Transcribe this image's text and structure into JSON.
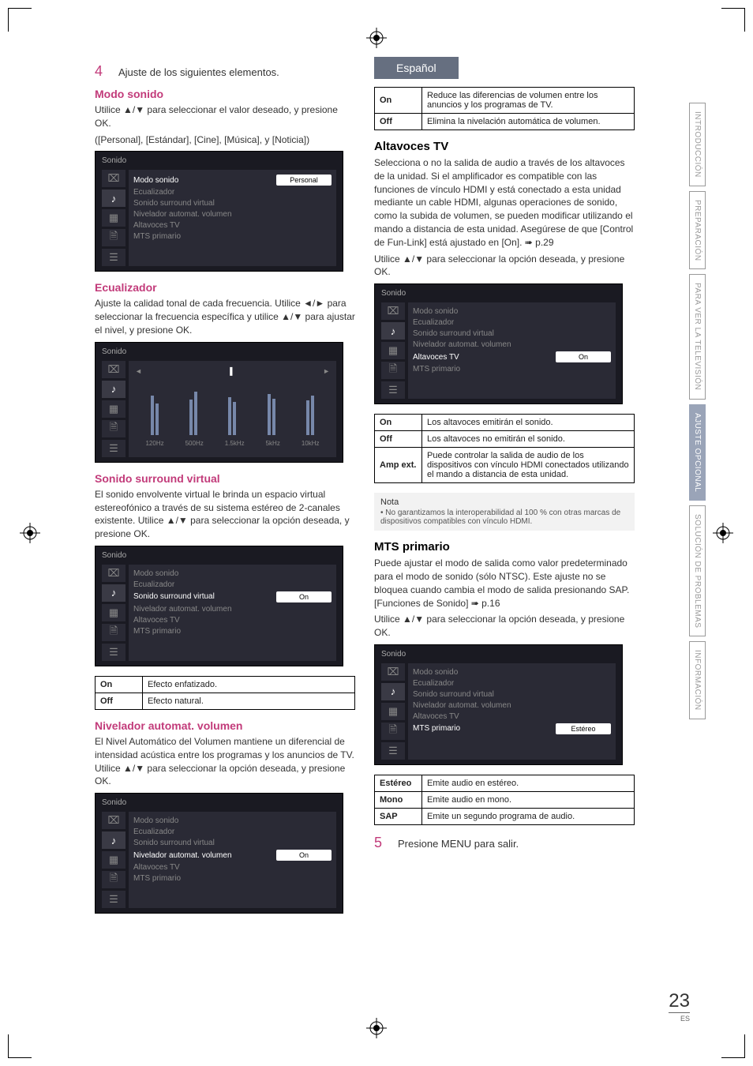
{
  "lang_tab": "Español",
  "step4": {
    "num": "4",
    "text": "Ajuste de los siguientes elementos."
  },
  "step5": {
    "num": "5",
    "text": "Presione MENU para salir."
  },
  "sections": {
    "modo_sonido": {
      "title": "Modo sonido",
      "body": "Utilice ▲/▼ para seleccionar el valor deseado, y presione OK.",
      "options": "([Personal], [Estándar], [Cine], [Música], y [Noticia])"
    },
    "ecualizador": {
      "title": "Ecualizador",
      "body": "Ajuste la calidad tonal de cada frecuencia. Utilice ◄/► para seleccionar la frecuencia específica y utilice ▲/▼ para ajustar el nivel, y presione OK."
    },
    "surround": {
      "title": "Sonido surround virtual",
      "body": "El sonido envolvente virtual le brinda un espacio virtual estereofónico a través de su sistema estéreo de 2-canales existente. Utilice ▲/▼ para seleccionar la opción deseada, y presione OK.",
      "table": {
        "on_label": "On",
        "on_desc": "Efecto enfatizado.",
        "off_label": "Off",
        "off_desc": "Efecto natural."
      }
    },
    "nivelador": {
      "title": "Nivelador automat. volumen",
      "body": "El Nivel Automático del Volumen mantiene un diferencial de intensidad acústica entre los programas y los anuncios de TV. Utilice ▲/▼ para seleccionar la opción deseada, y presione OK.",
      "table": {
        "on_label": "On",
        "on_desc": "Reduce las diferencias de volumen entre los anuncios y los programas de TV.",
        "off_label": "Off",
        "off_desc": "Elimina la nivelación automática de volumen."
      }
    },
    "altavoces": {
      "title": "Altavoces TV",
      "body1": "Selecciona o no la salida de audio a través de los altavoces de la unidad. Si el amplificador es compatible con las funciones de vínculo HDMI y está conectado a esta unidad mediante un cable HDMI, algunas operaciones de sonido, como la subida de volumen, se pueden modificar utilizando el mando a distancia de esta unidad. Asegúrese de que [Control de Fun-Link] está ajustado en [On]. ➠ p.29",
      "body2": "Utilice ▲/▼ para seleccionar la opción deseada, y presione OK.",
      "table": {
        "on_label": "On",
        "on_desc": "Los altavoces emitirán el sonido.",
        "off_label": "Off",
        "off_desc": "Los altavoces no emitirán el sonido.",
        "amp_label": "Amp ext.",
        "amp_desc": "Puede controlar la salida de audio de los dispositivos con vínculo HDMI conectados utilizando el mando a distancia de esta unidad."
      },
      "note_title": "Nota",
      "note_body": "No garantizamos la interoperabilidad al 100 % con otras marcas de dispositivos compatibles con vínculo HDMI."
    },
    "mts": {
      "title": "MTS primario",
      "body1": "Puede ajustar el modo de salida como valor predeterminado para el modo de sonido (sólo NTSC). Este ajuste no se bloquea cuando cambia el modo de salida presionando SAP. [Funciones de Sonido] ➠ p.16",
      "body2": "Utilice ▲/▼ para seleccionar la opción deseada, y presione OK.",
      "table": {
        "est_label": "Estéreo",
        "est_desc": "Emite audio en estéreo.",
        "mono_label": "Mono",
        "mono_desc": "Emite audio en mono.",
        "sap_label": "SAP",
        "sap_desc": "Emite un segundo programa de audio."
      }
    }
  },
  "osd": {
    "header_sonido": "Sonido",
    "modo_sonido": {
      "rows": [
        "Modo sonido",
        "Ecualizador",
        "Sonido surround virtual",
        "Nivelador automat. volumen",
        "Altavoces TV",
        "MTS primario"
      ],
      "sel_value": "Personal"
    },
    "surround_selected": "On",
    "nivelador_selected": "On",
    "altavoces_selected": "On",
    "mts_selected": "Estéreo",
    "eq_freqs": [
      "120Hz",
      "500Hz",
      "1.5kHz",
      "5kHz",
      "10kHz"
    ]
  },
  "side_tabs": [
    "INTRODUCCIÓN",
    "PREPARACIÓN",
    "PARA VER LA TELEVISIÓN",
    "AJUSTE OPCIONAL",
    "SOLUCIÓN DE PROBLEMAS",
    "INFORMACIÓN"
  ],
  "page": {
    "num": "23",
    "suffix": "ES"
  }
}
